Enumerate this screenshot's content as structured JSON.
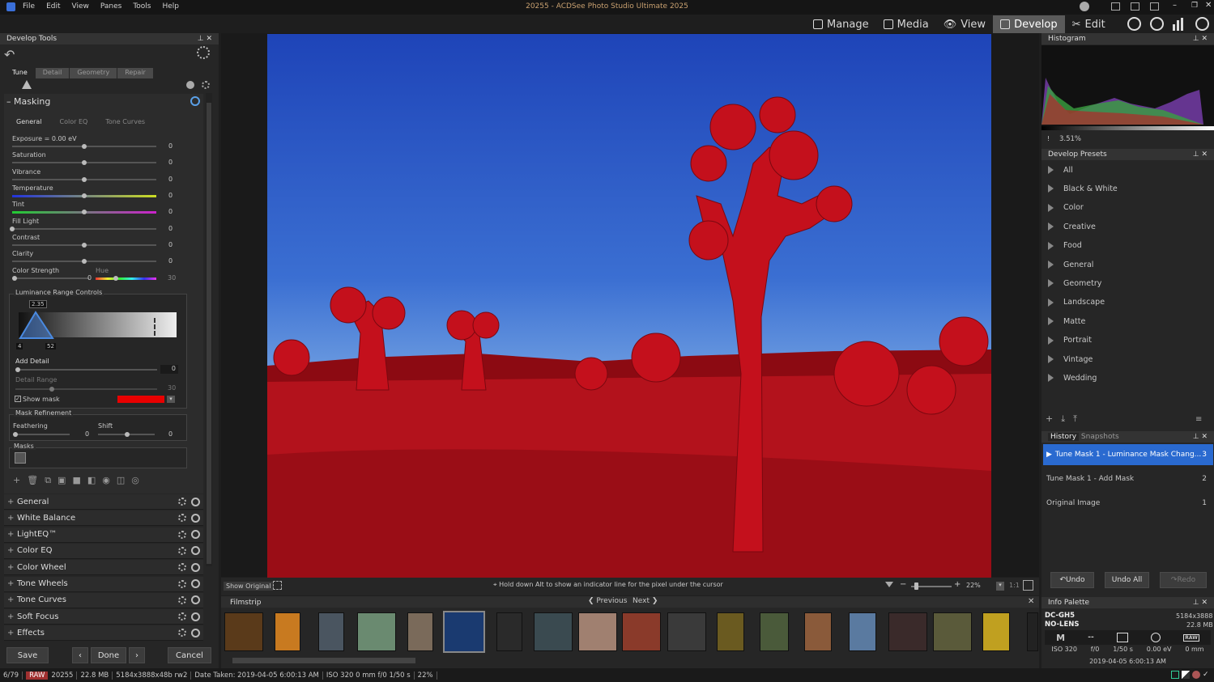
{
  "app": {
    "title": "20255 - ACDSee Photo Studio Ultimate 2025",
    "menu": [
      "File",
      "Edit",
      "View",
      "Panes",
      "Tools",
      "Help"
    ]
  },
  "modes": [
    {
      "label": "Manage",
      "icon": "grid-icon"
    },
    {
      "label": "Media",
      "icon": "media-icon"
    },
    {
      "label": "View",
      "icon": "eye-icon"
    },
    {
      "label": "Develop",
      "icon": "develop-icon",
      "active": true
    },
    {
      "label": "Edit",
      "icon": "edit-icon"
    }
  ],
  "left": {
    "title": "Develop Tools",
    "tabs": [
      "Tune",
      "Detail",
      "Geometry",
      "Repair"
    ],
    "masking": "Masking",
    "subtabs": [
      "General",
      "Color EQ",
      "Tone Curves"
    ],
    "sliders": [
      {
        "label": "Exposure = 0.00 eV",
        "value": "0",
        "pos": 0.5
      },
      {
        "label": "Saturation",
        "value": "0",
        "pos": 0.5
      },
      {
        "label": "Vibrance",
        "value": "0",
        "pos": 0.5
      },
      {
        "label": "Temperature",
        "value": "0",
        "pos": 0.5
      },
      {
        "label": "Tint",
        "value": "0",
        "pos": 0.5
      },
      {
        "label": "Fill Light",
        "value": "0",
        "pos": 0.0
      },
      {
        "label": "Contrast",
        "value": "0",
        "pos": 0.5
      },
      {
        "label": "Clarity",
        "value": "0",
        "pos": 0.5
      }
    ],
    "color_strength": {
      "label": "Color Strength",
      "value": "0",
      "hue_label": "Hue",
      "hue_value": "30"
    },
    "lrc": {
      "title": "Luminance Range Controls",
      "top": "2.35",
      "left": "4",
      "right": "52"
    },
    "add_detail": {
      "label": "Add Detail",
      "value": "0"
    },
    "detail_range": {
      "label": "Detail Range",
      "value": "30"
    },
    "show_mask": "Show mask",
    "mask_color": "#e80000",
    "refine": {
      "title": "Mask Refinement",
      "feathering": "Feathering",
      "feather_val": "0",
      "shift": "Shift",
      "shift_val": "0"
    },
    "masks": "Masks",
    "sections": [
      "General",
      "White Balance",
      "LightEQ™",
      "Color EQ",
      "Color Wheel",
      "Tone Wheels",
      "Tone Curves",
      "Soft Focus",
      "Effects"
    ],
    "buttons": {
      "save": "Save",
      "done": "Done",
      "cancel": "Cancel"
    }
  },
  "center": {
    "show_original": "Show Original",
    "hint": "Hold down Alt to show an indicator line for the pixel under the cursor",
    "zoom": "22%",
    "ratio": "1:1",
    "filmstrip": "Filmstrip",
    "previous": "Previous",
    "next": "Next"
  },
  "right": {
    "histogram": "Histogram",
    "hist_value": "3.51%",
    "presets_title": "Develop Presets",
    "presets": [
      "All",
      "Black & White",
      "Color",
      "Creative",
      "Food",
      "General",
      "Geometry",
      "Landscape",
      "Matte",
      "Portrait",
      "Vintage",
      "Wedding"
    ],
    "history_tab": "History",
    "snapshots_tab": "Snapshots",
    "history": [
      {
        "label": "Tune Mask 1 - Luminance Mask Chang...",
        "n": "3"
      },
      {
        "label": "Tune Mask 1 - Add Mask",
        "n": "2"
      },
      {
        "label": "Original Image",
        "n": "1"
      }
    ],
    "undo": "Undo",
    "undo_all": "Undo All",
    "redo": "Redo",
    "info": {
      "title": "Info Palette",
      "camera": "DC-GH5",
      "dims": "5184x3888",
      "lens": "NO-LENS",
      "size": "22.8 MB",
      "mode": "M",
      "dash": "--",
      "raw": "RAW",
      "iso": "ISO 320",
      "f": "f/0",
      "shutter": "1/50 s",
      "ev": "0.00 eV",
      "mm": "0 mm",
      "date": "2019-04-05 6:00:13 AM"
    }
  },
  "status": {
    "index": "6/79",
    "type": "RAW",
    "name": "20255",
    "size": "22.8 MB",
    "dims": "5184x3888x48b rw2",
    "date": "Date Taken: 2019-04-05 6:00:13 AM",
    "exif": "ISO 320   0 mm   f/0   1/50 s",
    "zoom": "22%"
  }
}
